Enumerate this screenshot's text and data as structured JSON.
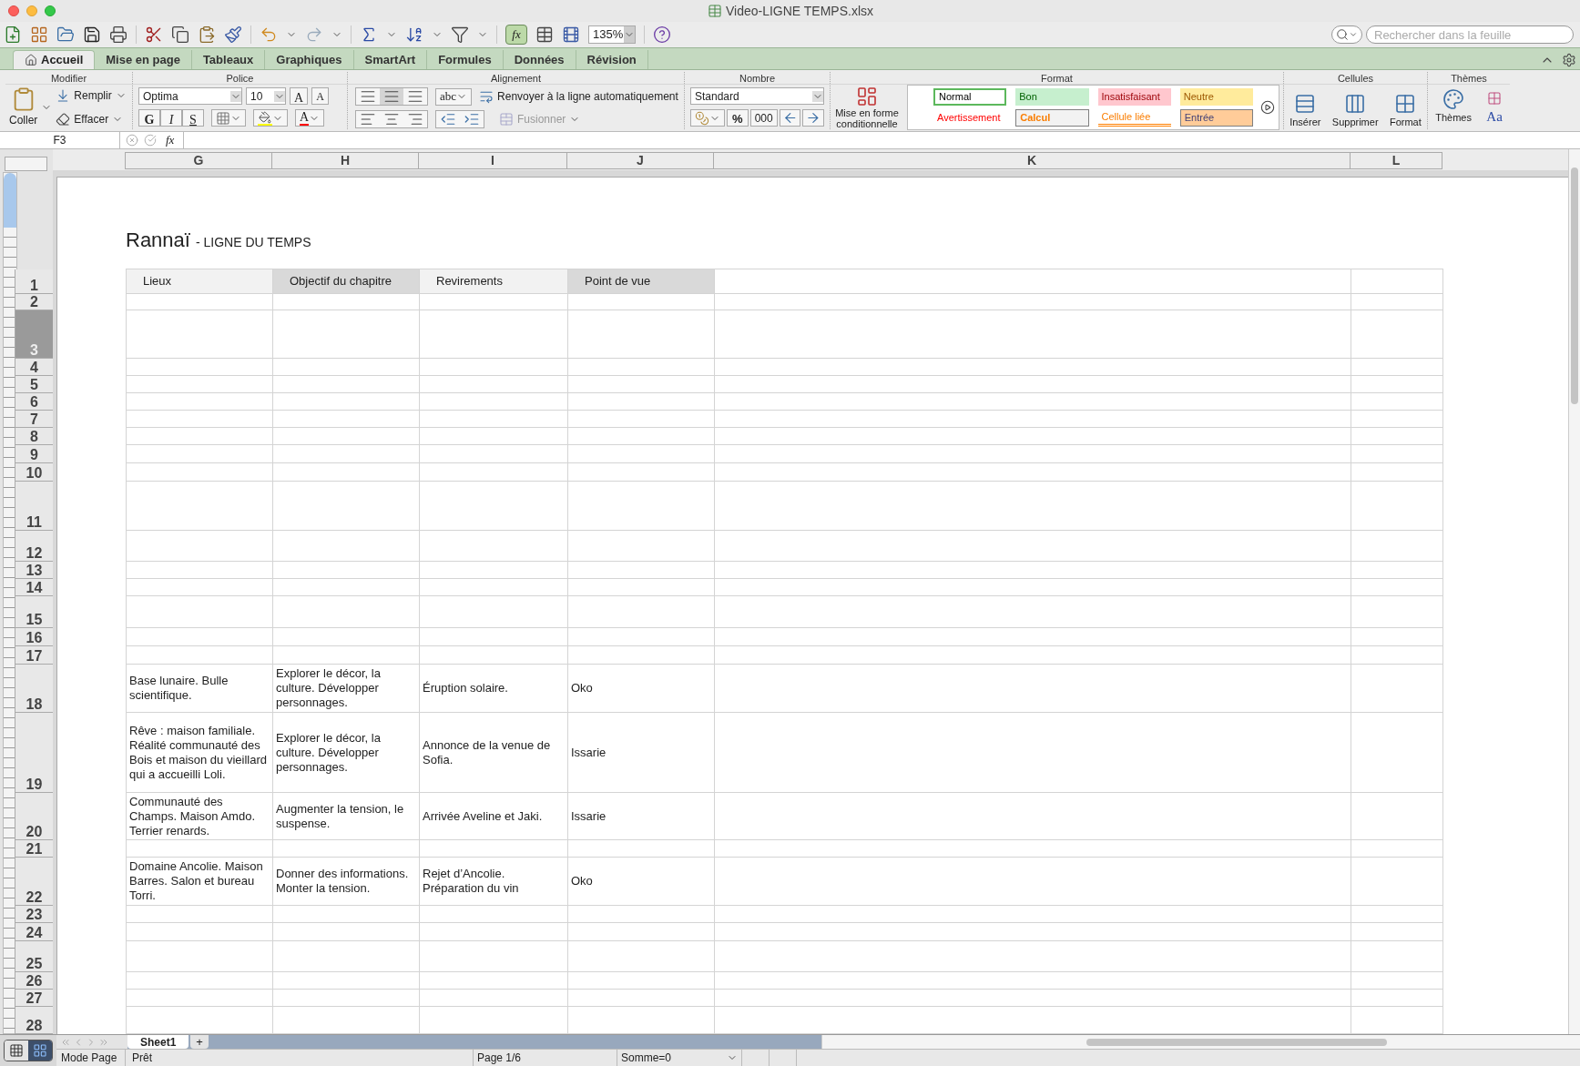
{
  "window": {
    "title": "Video-LIGNE TEMPS.xlsx"
  },
  "toolbar": {
    "zoom": "135%",
    "search": {
      "placeholder": "Rechercher dans la feuille"
    }
  },
  "ribbon_tabs": [
    {
      "label": "Accueil",
      "selected": true
    },
    {
      "label": "Mise en page",
      "selected": false
    },
    {
      "label": "Tableaux",
      "selected": false
    },
    {
      "label": "Graphiques",
      "selected": false
    },
    {
      "label": "SmartArt",
      "selected": false
    },
    {
      "label": "Formules",
      "selected": false
    },
    {
      "label": "Données",
      "selected": false
    },
    {
      "label": "Révision",
      "selected": false
    }
  ],
  "ribbon": {
    "modifier": {
      "title": "Modifier",
      "paste": "Coller",
      "fill": "Remplir",
      "clear": "Effacer"
    },
    "police": {
      "title": "Police",
      "font": "Optima",
      "size": "10",
      "grow": "A",
      "shrink": "A",
      "bold": "G",
      "italic": "I",
      "underline": "S",
      "font_color": "A"
    },
    "alignement": {
      "title": "Alignement",
      "orientation": "abc",
      "wrap": "Renvoyer à la ligne automatiquement",
      "merge": "Fusionner"
    },
    "nombre": {
      "title": "Nombre",
      "format": "Standard",
      "percent": "%",
      "thousands": "000"
    },
    "format": {
      "title": "Format",
      "conditional": "Mise en forme conditionnelle",
      "styles": [
        {
          "label": "Normal",
          "kind": "normal"
        },
        {
          "label": "Bon",
          "kind": "good"
        },
        {
          "label": "Insatisfaisant",
          "kind": "bad"
        },
        {
          "label": "Neutre",
          "kind": "neutral"
        },
        {
          "label": "Avertissement",
          "kind": "warning"
        },
        {
          "label": "Calcul",
          "kind": "calc"
        },
        {
          "label": "Cellule liée",
          "kind": "linked"
        },
        {
          "label": "Entrée",
          "kind": "input"
        }
      ]
    },
    "cellules": {
      "title": "Cellules",
      "buttons": [
        "Insérer",
        "Supprimer",
        "Format"
      ]
    },
    "themes": {
      "title": "Thèmes",
      "button": "Thèmes",
      "fonts": "Aa"
    }
  },
  "formula_bar": {
    "cell": "F3",
    "fx": "fx"
  },
  "formula_builder": "fx",
  "sheet": {
    "columns": [
      "G",
      "H",
      "I",
      "J",
      "K",
      "L"
    ],
    "title": "Rannaï",
    "subtitle": "- LIGNE DU TEMPS",
    "header": [
      {
        "label": "Lieux",
        "color": "#f2f2f2"
      },
      {
        "label": "Objectif du chapitre",
        "color": "#d9d9d9"
      },
      {
        "label": "Revirements",
        "color": "#f2f2f2"
      },
      {
        "label": "Point de vue",
        "color": "#d9d9d9"
      }
    ],
    "rows": [
      {
        "number": "1",
        "selected": false
      },
      {
        "number": "2",
        "selected": false
      },
      {
        "number": "3",
        "selected": true
      },
      {
        "number": "4",
        "selected": false
      },
      {
        "number": "5",
        "selected": false
      },
      {
        "number": "6",
        "selected": false
      },
      {
        "number": "7",
        "selected": false
      },
      {
        "number": "8",
        "selected": false
      },
      {
        "number": "9",
        "selected": false
      },
      {
        "number": "10",
        "selected": false
      },
      {
        "number": "11",
        "selected": false
      },
      {
        "number": "12",
        "selected": false
      },
      {
        "number": "13",
        "selected": false
      },
      {
        "number": "14",
        "selected": false
      },
      {
        "number": "15",
        "selected": false
      },
      {
        "number": "16",
        "selected": false
      },
      {
        "number": "17",
        "selected": false
      },
      {
        "number": "18",
        "selected": false,
        "cells": [
          "Base lunaire. Bulle scientifique.",
          "Explorer le décor, la culture. Développer personnages.",
          "Éruption solaire.",
          "Oko"
        ]
      },
      {
        "number": "19",
        "selected": false,
        "cells": [
          "Rêve : maison familiale. Réalité communauté des Bois et maison du vieillard qui a accueilli Loli.",
          "Explorer le décor, la culture. Développer personnages.",
          "Annonce de la venue de Sofia.",
          "Issarie"
        ]
      },
      {
        "number": "20",
        "selected": false,
        "cells": [
          "Communauté des Champs. Maison Amdo. Terrier renards.",
          "Augmenter la tension, le suspense.",
          "Arrivée Aveline et Jaki.",
          "Issarie"
        ]
      },
      {
        "number": "21",
        "selected": false
      },
      {
        "number": "22",
        "selected": false,
        "cells": [
          "Domaine Ancolie. Maison Barres. Salon et bureau Torri.",
          "Donner des informations. Monter la tension.",
          "Rejet d’Ancolie. Préparation du vin",
          "Oko"
        ]
      },
      {
        "number": "23",
        "selected": false
      },
      {
        "number": "24",
        "selected": false
      },
      {
        "number": "25",
        "selected": false
      },
      {
        "number": "26",
        "selected": false
      },
      {
        "number": "27",
        "selected": false
      },
      {
        "number": "28",
        "selected": false
      }
    ]
  },
  "view_buttons": [
    {
      "kind": "normal",
      "selected": false
    },
    {
      "kind": "page",
      "selected": true
    }
  ],
  "sheet_tabs": [
    {
      "label": "Sheet1",
      "selected": true
    }
  ],
  "add_sheet": "+",
  "status_bar": {
    "view": "Mode Page",
    "state": "Prêt",
    "page": "Page 1/6",
    "sum": "Somme=0"
  }
}
